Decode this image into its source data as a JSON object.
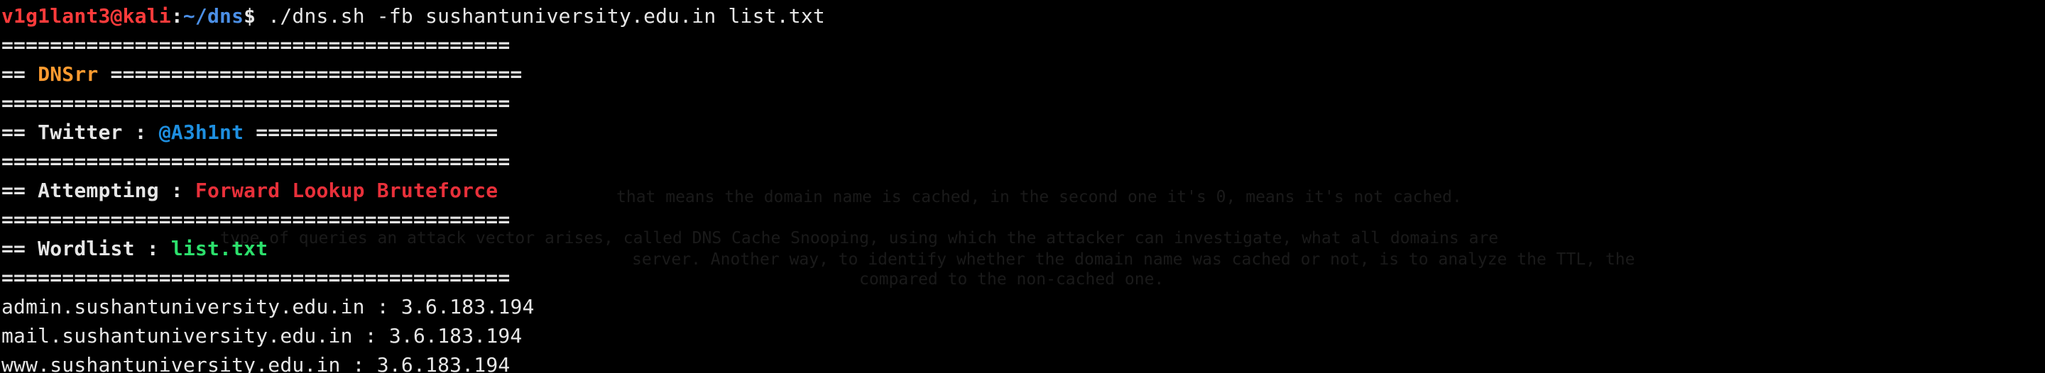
{
  "prompt": {
    "user_host": "v1g1lant3@kali",
    "separator": ":",
    "path": "~/dns",
    "symbol": "$",
    "command": " ./dns.sh -fb sushantuniversity.edu.in list.txt"
  },
  "banner": {
    "rule": "==========================================",
    "tool_prefix": "== ",
    "tool_name": "DNSrr",
    "tool_suffix": " ==================================",
    "twitter_prefix": "== Twitter : ",
    "twitter_handle": "@A3h1nt",
    "twitter_suffix": " ====================",
    "attempting_prefix": "== Attempting : ",
    "attempting_value": "Forward Lookup Bruteforce",
    "wordlist_prefix": "== Wordlist : ",
    "wordlist_value": "list.txt"
  },
  "results": [
    {
      "host": "admin.sushantuniversity.edu.in",
      "sep": " : ",
      "ip": "3.6.183.194"
    },
    {
      "host": "mail.sushantuniversity.edu.in",
      "sep": " : ",
      "ip": "3.6.183.194"
    },
    {
      "host": "www.sushantuniversity.edu.in",
      "sep": " : ",
      "ip": "3.6.183.194"
    }
  ],
  "background_text": {
    "line1": "that means the domain name is cached, in the second one it's 0, means it's not cached.",
    "line2": "type of queries an attack vector arises, called DNS Cache Snooping, using which the attacker can investigate, what all domains are",
    "line3": "server. Another way, to identify whether the domain name was cached or not, is to analyze the TTL, the",
    "line4": "compared to the non-cached one."
  },
  "colors": {
    "background": "#000000",
    "text": "#e6e6e6",
    "prompt_user": "#ff3b3b",
    "prompt_path": "#4b8fe6",
    "tool_name": "#ff9b30",
    "twitter_handle": "#1e8fe0",
    "attempting_value": "#e8303a",
    "wordlist_value": "#2ce06c"
  }
}
